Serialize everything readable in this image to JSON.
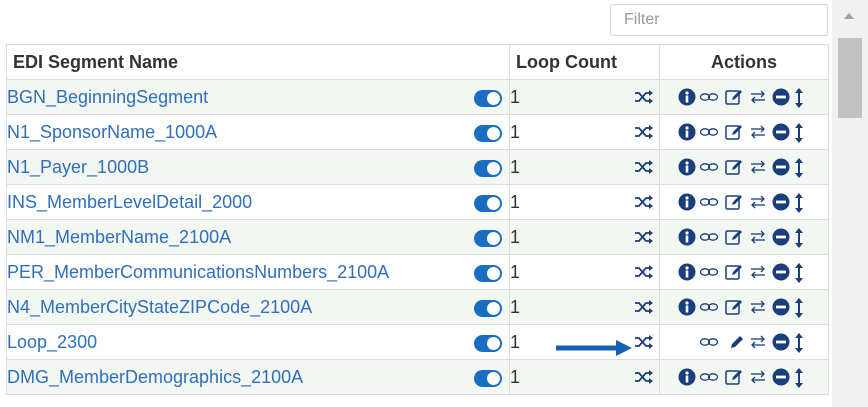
{
  "filter": {
    "placeholder": "Filter",
    "value": ""
  },
  "table": {
    "headers": {
      "name": "EDI Segment Name",
      "loop_count": "Loop Count",
      "actions": "Actions"
    },
    "rows": [
      {
        "name": "BGN_BeginningSegment",
        "enabled": true,
        "loop_count": "1",
        "has_info": true,
        "edit_icon": "edit-box"
      },
      {
        "name": "N1_SponsorName_1000A",
        "enabled": true,
        "loop_count": "1",
        "has_info": true,
        "edit_icon": "edit-box"
      },
      {
        "name": "N1_Payer_1000B",
        "enabled": true,
        "loop_count": "1",
        "has_info": true,
        "edit_icon": "edit-box"
      },
      {
        "name": "INS_MemberLevelDetail_2000",
        "enabled": true,
        "loop_count": "1",
        "has_info": true,
        "edit_icon": "edit-box"
      },
      {
        "name": "NM1_MemberName_2100A",
        "enabled": true,
        "loop_count": "1",
        "has_info": true,
        "edit_icon": "edit-box"
      },
      {
        "name": "PER_MemberCommunicationsNumbers_2100A",
        "enabled": true,
        "loop_count": "1",
        "has_info": true,
        "edit_icon": "edit-box"
      },
      {
        "name": "N4_MemberCityStateZIPCode_2100A",
        "enabled": true,
        "loop_count": "1",
        "has_info": true,
        "edit_icon": "edit-box"
      },
      {
        "name": "Loop_2300",
        "enabled": true,
        "loop_count": "1",
        "has_info": false,
        "edit_icon": "pencil"
      },
      {
        "name": "DMG_MemberDemographics_2100A",
        "enabled": true,
        "loop_count": "1",
        "has_info": true,
        "edit_icon": "edit-box"
      }
    ]
  },
  "icons": {
    "shuffle": "shuffle-icon",
    "info": "info-icon",
    "link": "infinity-link-icon",
    "edit": "edit-icon",
    "swap": "swap-icon",
    "remove": "minus-circle-icon",
    "reorder": "vertical-arrows-icon"
  },
  "colors": {
    "link": "#2f6fbb",
    "toggle": "#1a6ec1",
    "icon": "#1a3d7c",
    "annotation_arrow": "#1560b0",
    "row_alt": "#f2f7f2"
  }
}
